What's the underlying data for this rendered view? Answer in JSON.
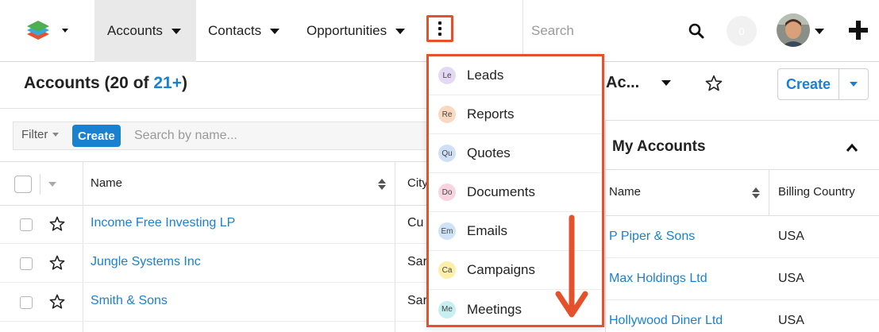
{
  "topnav": {
    "tabs": [
      {
        "label": "Accounts",
        "active": true
      },
      {
        "label": "Contacts",
        "active": false
      },
      {
        "label": "Opportunities",
        "active": false
      }
    ],
    "search_placeholder": "Search",
    "notification_count": "0",
    "icons": {
      "more": "kebab-menu-icon",
      "search": "search-icon",
      "plus": "plus-icon",
      "logo": "stacked-layers-logo"
    }
  },
  "overflow_menu": {
    "highlight_color": "#e5512b",
    "items": [
      {
        "abbr": "Le",
        "label": "Leads",
        "color": "#e3d9f4"
      },
      {
        "abbr": "Re",
        "label": "Reports",
        "color": "#fbd9c0"
      },
      {
        "abbr": "Qu",
        "label": "Quotes",
        "color": "#cfe0f6"
      },
      {
        "abbr": "Do",
        "label": "Documents",
        "color": "#f8d3e0"
      },
      {
        "abbr": "Em",
        "label": "Emails",
        "color": "#cfe3f7"
      },
      {
        "abbr": "Ca",
        "label": "Campaigns",
        "color": "#fbefa9"
      },
      {
        "abbr": "Me",
        "label": "Meetings",
        "color": "#c7eef0"
      }
    ]
  },
  "list": {
    "title": "Accounts (20 of ",
    "count": "21+",
    "title_suffix": ")",
    "filter_label": "Filter",
    "create_label": "Create",
    "search_placeholder": "Search by name...",
    "columns": {
      "name": "Name",
      "city": "City"
    },
    "rows": [
      {
        "name": "Income Free Investing LP",
        "city": "Cu"
      },
      {
        "name": "Jungle Systems Inc",
        "city": "Sar"
      },
      {
        "name": "Smith & Sons",
        "city": "Sar"
      }
    ]
  },
  "dashboard": {
    "title": "Ac...",
    "create_label": "Create",
    "dashlet_title": "My Accounts",
    "columns": {
      "name": "Name",
      "country": "Billing Country"
    },
    "rows": [
      {
        "name": "P Piper & Sons",
        "country": "USA"
      },
      {
        "name": "Max Holdings Ltd",
        "country": "USA"
      },
      {
        "name": "Hollywood Diner Ltd",
        "country": "USA"
      }
    ]
  },
  "colors": {
    "link": "#1a81d1",
    "accent": "#1a81d1",
    "annotation": "#e5512b"
  }
}
